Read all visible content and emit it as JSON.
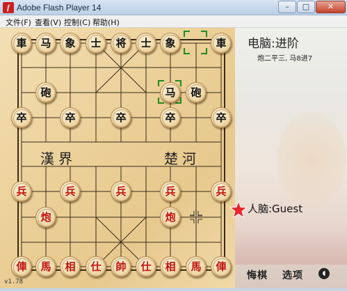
{
  "window": {
    "title": "Adobe Flash Player 14",
    "minimize": "–",
    "maximize": "□",
    "close": "✕"
  },
  "menu": [
    "文件(F)",
    "查看(V)",
    "控制(C)",
    "帮助(H)"
  ],
  "board": {
    "river_left": "漢界",
    "river_right": "楚河",
    "version": "v1.78"
  },
  "pieces": {
    "black_back_row": [
      "車",
      "马",
      "象",
      "士",
      "将",
      "士",
      "象",
      "",
      "車"
    ],
    "black_horse_moved": "马",
    "black_cannon_1": "砲",
    "black_cannon_2": "砲",
    "black_soldiers": [
      "卒",
      "卒",
      "卒",
      "卒",
      "卒"
    ],
    "red_soldiers": [
      "兵",
      "兵",
      "兵",
      "兵",
      "兵"
    ],
    "red_cannon_1": "炮",
    "red_cannon_2": "炮",
    "red_back_row": [
      "俥",
      "馬",
      "相",
      "仕",
      "帥",
      "仕",
      "相",
      "馬",
      "俥"
    ]
  },
  "panel": {
    "ai_label": "电脑:进阶",
    "last_move": "炮二平三, 马8进7",
    "human_label": "人脑:Guest",
    "undo_button": "悔棋",
    "options_button": "选项",
    "sound_icon": "speaker-icon"
  },
  "colors": {
    "red_piece_text": "#c0150e",
    "black_piece_text": "#111111",
    "selection": "#1f8a1f",
    "board_line": "#3a2a18"
  }
}
